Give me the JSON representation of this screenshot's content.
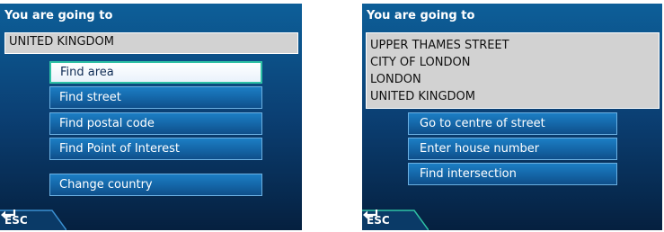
{
  "left_screen": {
    "header": "You are going to",
    "destination": "UNITED KINGDOM",
    "menu": [
      "Find area",
      "Find street",
      "Find postal code",
      "Find Point of Interest",
      "Change country"
    ],
    "selected_item": "Find area",
    "esc_label": "ESC",
    "esc_icon": "return-arrow-icon"
  },
  "right_screen": {
    "header": "You are going to",
    "destination_lines": [
      "UPPER THAMES STREET",
      "CITY OF LONDON",
      "LONDON",
      "UNITED KINGDOM"
    ],
    "menu": [
      "Go to centre of street",
      "Enter house number",
      "Find intersection"
    ],
    "esc_label": "ESC",
    "esc_icon": "return-arrow-icon"
  },
  "colors": {
    "background_top": "#0d5f99",
    "background_bottom": "#05203f",
    "button_blue": "#1465a6",
    "selected_border": "#2fc1a5",
    "destination_box": "#d2d2d2"
  }
}
